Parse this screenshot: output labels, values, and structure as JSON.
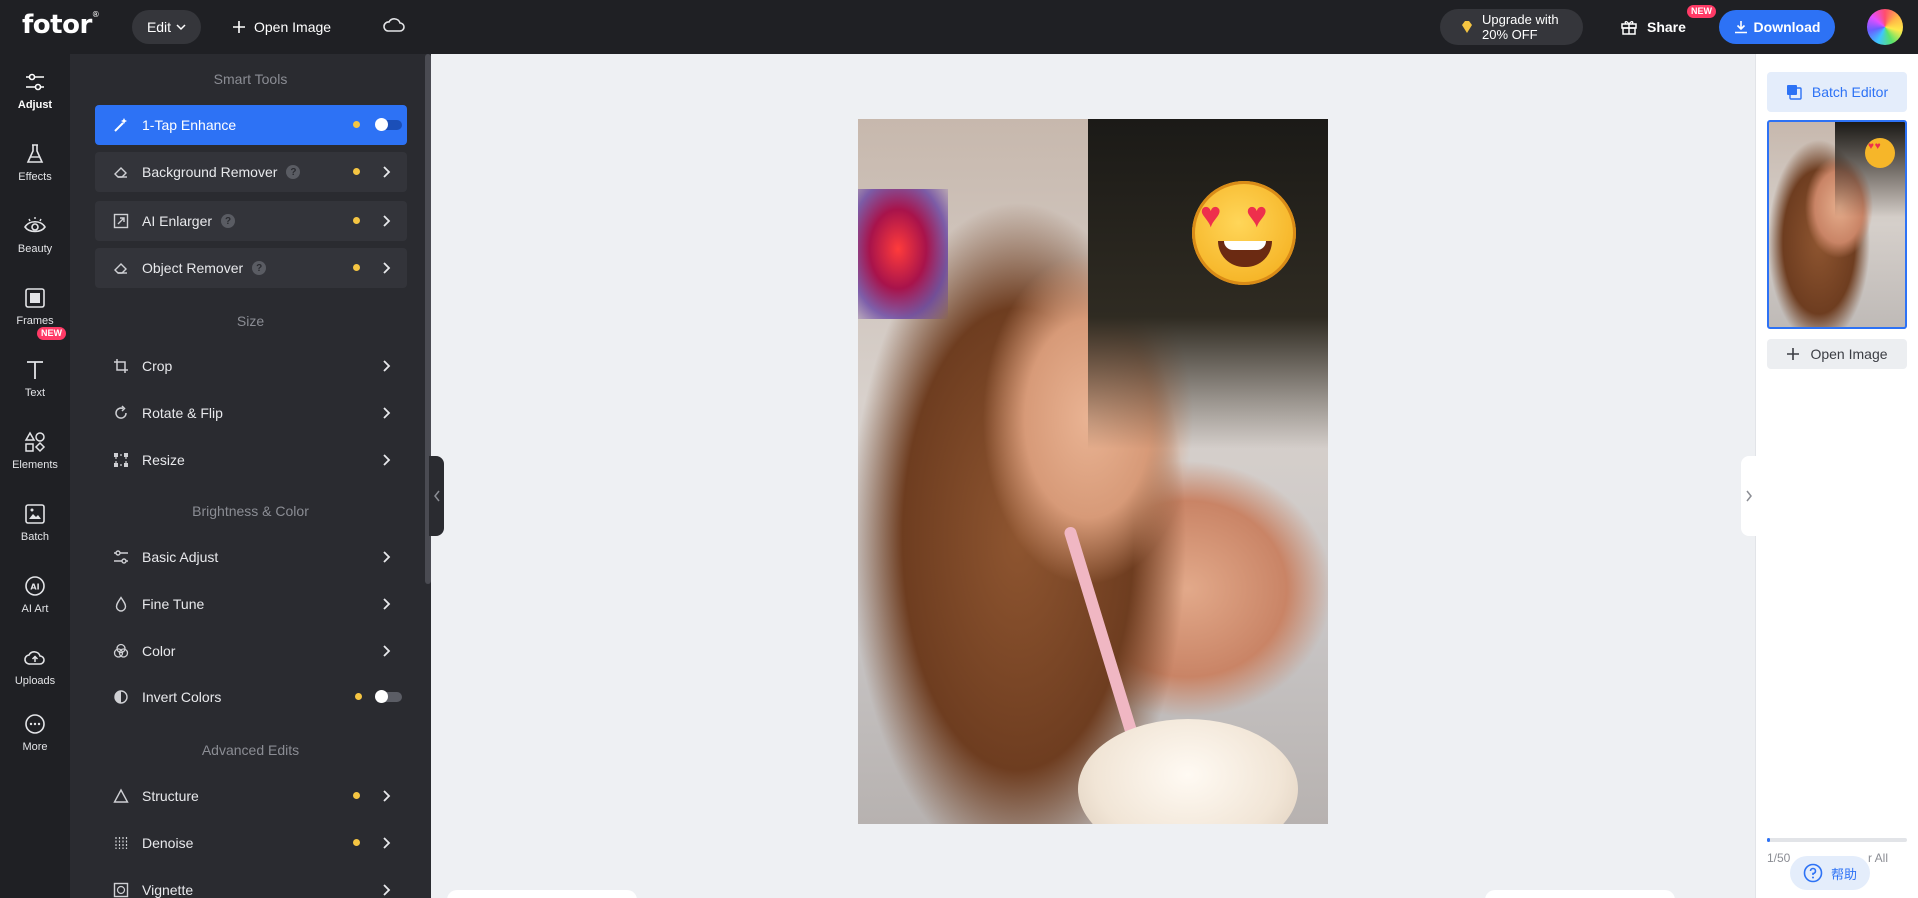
{
  "app": {
    "logo": "fotor",
    "logo_mark": "®"
  },
  "topbar": {
    "edit_label": "Edit",
    "open_image_label": "Open Image",
    "upgrade_line1": "Upgrade with",
    "upgrade_line2": "20% OFF",
    "share_label": "Share",
    "share_badge": "NEW",
    "download_label": "Download"
  },
  "rail": {
    "items": [
      {
        "label": "Adjust",
        "icon": "sliders-icon"
      },
      {
        "label": "Effects",
        "icon": "flask-icon"
      },
      {
        "label": "Beauty",
        "icon": "eye-icon"
      },
      {
        "label": "Frames",
        "icon": "frame-icon",
        "badge": "NEW"
      },
      {
        "label": "Text",
        "icon": "text-icon"
      },
      {
        "label": "Elements",
        "icon": "shapes-icon"
      },
      {
        "label": "Batch",
        "icon": "batch-icon"
      },
      {
        "label": "AI Art",
        "icon": "ai-icon"
      },
      {
        "label": "Uploads",
        "icon": "cloud-upload-icon"
      },
      {
        "label": "More",
        "icon": "more-icon"
      }
    ]
  },
  "panel": {
    "sections": {
      "smart_tools": "Smart Tools",
      "size": "Size",
      "brightness_color": "Brightness & Color",
      "advanced_edits": "Advanced Edits"
    },
    "tools": {
      "one_tap_enhance": "1-Tap Enhance",
      "background_remover": "Background Remover",
      "ai_enlarger": "AI Enlarger",
      "object_remover": "Object Remover",
      "crop": "Crop",
      "rotate_flip": "Rotate & Flip",
      "resize": "Resize",
      "basic_adjust": "Basic Adjust",
      "fine_tune": "Fine Tune",
      "color": "Color",
      "invert_colors": "Invert Colors",
      "structure": "Structure",
      "denoise": "Denoise",
      "vignette": "Vignette"
    },
    "help_glyph": "?"
  },
  "right_panel": {
    "batch_editor_label": "Batch Editor",
    "open_image_label": "Open Image",
    "count": "1/50",
    "clear_all": "r All",
    "help_label": "帮助",
    "progress_fraction": 0.02
  },
  "colors": {
    "accent": "#2d72f5",
    "dark_bg": "#1f2024",
    "panel_bg": "#2a2b30",
    "premium_dot": "#f5c542"
  }
}
